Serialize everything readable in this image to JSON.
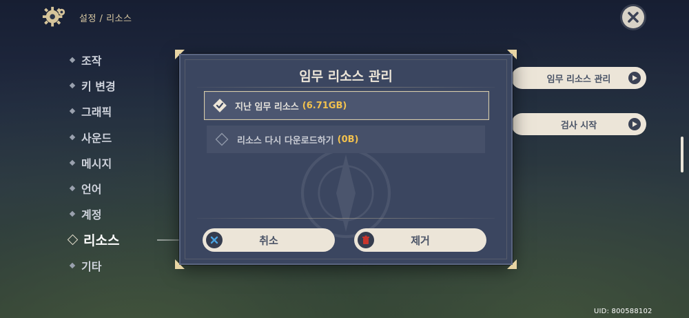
{
  "header": {
    "breadcrumb": "설정 / 리소스"
  },
  "sidebar": {
    "items": [
      {
        "label": "조작"
      },
      {
        "label": "키 변경"
      },
      {
        "label": "그래픽"
      },
      {
        "label": "사운드"
      },
      {
        "label": "메시지"
      },
      {
        "label": "언어"
      },
      {
        "label": "계정"
      },
      {
        "label": "리소스"
      },
      {
        "label": "기타"
      }
    ],
    "active_index": 7
  },
  "right_panel": {
    "manage_button": "임무 리소스 관리",
    "check_button": "검사 시작"
  },
  "dialog": {
    "title": "임무 리소스 관리",
    "options": [
      {
        "label": "지난 임무 리소스",
        "size": "(6.71GB)",
        "checked": true
      },
      {
        "label": "리소스 다시 다운로드하기",
        "size": "(0B)",
        "checked": false
      }
    ],
    "cancel_label": "취소",
    "remove_label": "제거"
  },
  "footer": {
    "uid": "UID: 800588102"
  },
  "colors": {
    "accent_gold": "#f2c14e",
    "button_bg": "#ece5d8",
    "dialog_bg": "#3b4660",
    "remove_icon": "#c8342c",
    "cancel_icon": "#4aa3e0"
  },
  "icons": {
    "settings": "gear-icon",
    "close": "close-icon",
    "arrow": "play-arrow-icon",
    "checked": "diamond-check-icon",
    "unchecked": "diamond-outline-icon",
    "cancel": "x-icon",
    "remove": "trash-icon"
  }
}
